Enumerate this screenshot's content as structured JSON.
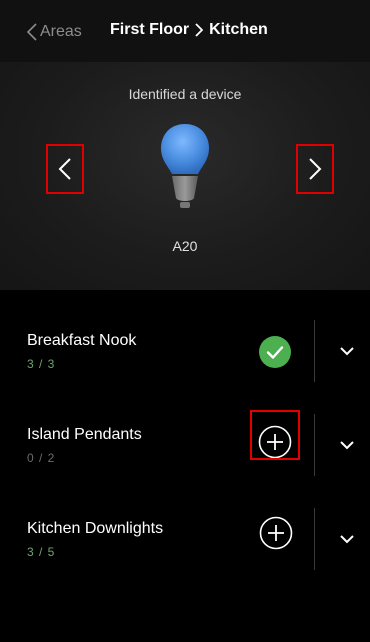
{
  "header": {
    "back_label": "Areas",
    "title_parent": "First Floor",
    "title_current": "Kitchen"
  },
  "hero": {
    "status_text": "Identified a device",
    "device_model": "A20",
    "bulb_color": "#4a8ee0"
  },
  "rows": [
    {
      "name": "Breakfast Nook",
      "count": "3 / 3",
      "action": "check",
      "action_icon": "check-circle-icon"
    },
    {
      "name": "Island Pendants",
      "count": "0 / 2",
      "action": "add",
      "action_icon": "plus-circle-icon"
    },
    {
      "name": "Kitchen Downlights",
      "count": "3 / 5",
      "action": "add",
      "action_icon": "plus-circle-icon"
    }
  ],
  "colors": {
    "highlight": "#e10000",
    "success": "#4caf50",
    "count_active": "#6ea56e"
  }
}
